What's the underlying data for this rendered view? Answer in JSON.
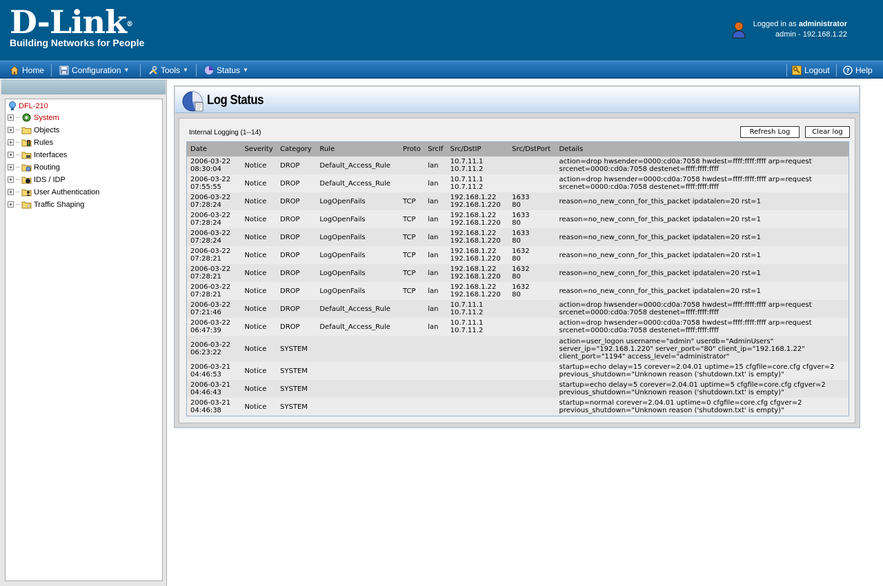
{
  "header": {
    "logo_main": "D-Link",
    "logo_reg": "®",
    "logo_tagline": "Building Networks for People",
    "logged_in_prefix": "Logged in as",
    "logged_in_user": "administrator",
    "session_info": "admin - 192.168.1.22"
  },
  "menu": {
    "home": "Home",
    "configuration": "Configuration",
    "tools": "Tools",
    "status": "Status",
    "logout": "Logout",
    "help": "Help"
  },
  "tree": {
    "root": "DFL-210",
    "items": [
      {
        "label": "System",
        "icon": "system-gear-icon",
        "active": true
      },
      {
        "label": "Objects",
        "icon": "folder-icon",
        "active": false
      },
      {
        "label": "Rules",
        "icon": "rules-icon",
        "active": false
      },
      {
        "label": "Interfaces",
        "icon": "interfaces-icon",
        "active": false
      },
      {
        "label": "Routing",
        "icon": "routing-icon",
        "active": false
      },
      {
        "label": "IDS / IDP",
        "icon": "ids-icon",
        "active": false
      },
      {
        "label": "User Authentication",
        "icon": "user-auth-icon",
        "active": false
      },
      {
        "label": "Traffic Shaping",
        "icon": "traffic-shaping-icon",
        "active": false
      }
    ]
  },
  "page": {
    "title": "Log Status",
    "caption": "Internal Logging (1--14)",
    "refresh_label": "Refresh Log",
    "clear_label": "Clear log"
  },
  "log": {
    "columns": [
      "Date",
      "Severity",
      "Category",
      "Rule",
      "Proto",
      "SrcIf",
      "Src/DstIP",
      "Src/DstPort",
      "Details"
    ],
    "rows": [
      {
        "date1": "2006-03-22",
        "date2": "08:30:04",
        "severity": "Notice",
        "category": "DROP",
        "rule": "Default_Access_Rule",
        "proto": "",
        "srcif": "lan",
        "ip1": "10.7.11.1",
        "ip2": "10.7.11.2",
        "port1": "",
        "port2": "",
        "details": "action=drop hwsender=0000:cd0a:7058 hwdest=ffff:ffff:ffff arp=request srcenet=0000:cd0a:7058 destenet=ffff:ffff:ffff"
      },
      {
        "date1": "2006-03-22",
        "date2": "07:55:55",
        "severity": "Notice",
        "category": "DROP",
        "rule": "Default_Access_Rule",
        "proto": "",
        "srcif": "lan",
        "ip1": "10.7.11.1",
        "ip2": "10.7.11.2",
        "port1": "",
        "port2": "",
        "details": "action=drop hwsender=0000:cd0a:7058 hwdest=ffff:ffff:ffff arp=request srcenet=0000:cd0a:7058 destenet=ffff:ffff:ffff"
      },
      {
        "date1": "2006-03-22",
        "date2": "07:28:24",
        "severity": "Notice",
        "category": "DROP",
        "rule": "LogOpenFails",
        "proto": "TCP",
        "srcif": "lan",
        "ip1": "192.168.1.22",
        "ip2": "192.168.1.220",
        "port1": "1633",
        "port2": "80",
        "details": "reason=no_new_conn_for_this_packet ipdatalen=20 rst=1"
      },
      {
        "date1": "2006-03-22",
        "date2": "07:28:24",
        "severity": "Notice",
        "category": "DROP",
        "rule": "LogOpenFails",
        "proto": "TCP",
        "srcif": "lan",
        "ip1": "192.168.1.22",
        "ip2": "192.168.1.220",
        "port1": "1633",
        "port2": "80",
        "details": "reason=no_new_conn_for_this_packet ipdatalen=20 rst=1"
      },
      {
        "date1": "2006-03-22",
        "date2": "07:28:24",
        "severity": "Notice",
        "category": "DROP",
        "rule": "LogOpenFails",
        "proto": "TCP",
        "srcif": "lan",
        "ip1": "192.168.1.22",
        "ip2": "192.168.1.220",
        "port1": "1633",
        "port2": "80",
        "details": "reason=no_new_conn_for_this_packet ipdatalen=20 rst=1"
      },
      {
        "date1": "2006-03-22",
        "date2": "07:28:21",
        "severity": "Notice",
        "category": "DROP",
        "rule": "LogOpenFails",
        "proto": "TCP",
        "srcif": "lan",
        "ip1": "192.168.1.22",
        "ip2": "192.168.1.220",
        "port1": "1632",
        "port2": "80",
        "details": "reason=no_new_conn_for_this_packet ipdatalen=20 rst=1"
      },
      {
        "date1": "2006-03-22",
        "date2": "07:28:21",
        "severity": "Notice",
        "category": "DROP",
        "rule": "LogOpenFails",
        "proto": "TCP",
        "srcif": "lan",
        "ip1": "192.168.1.22",
        "ip2": "192.168.1.220",
        "port1": "1632",
        "port2": "80",
        "details": "reason=no_new_conn_for_this_packet ipdatalen=20 rst=1"
      },
      {
        "date1": "2006-03-22",
        "date2": "07:28:21",
        "severity": "Notice",
        "category": "DROP",
        "rule": "LogOpenFails",
        "proto": "TCP",
        "srcif": "lan",
        "ip1": "192.168.1.22",
        "ip2": "192.168.1.220",
        "port1": "1632",
        "port2": "80",
        "details": "reason=no_new_conn_for_this_packet ipdatalen=20 rst=1"
      },
      {
        "date1": "2006-03-22",
        "date2": "07:21:46",
        "severity": "Notice",
        "category": "DROP",
        "rule": "Default_Access_Rule",
        "proto": "",
        "srcif": "lan",
        "ip1": "10.7.11.1",
        "ip2": "10.7.11.2",
        "port1": "",
        "port2": "",
        "details": "action=drop hwsender=0000:cd0a:7058 hwdest=ffff:ffff:ffff arp=request srcenet=0000:cd0a:7058 destenet=ffff:ffff:ffff"
      },
      {
        "date1": "2006-03-22",
        "date2": "06:47:39",
        "severity": "Notice",
        "category": "DROP",
        "rule": "Default_Access_Rule",
        "proto": "",
        "srcif": "lan",
        "ip1": "10.7.11.1",
        "ip2": "10.7.11.2",
        "port1": "",
        "port2": "",
        "details": "action=drop hwsender=0000:cd0a:7058 hwdest=ffff:ffff:ffff arp=request srcenet=0000:cd0a:7058 destenet=ffff:ffff:ffff"
      },
      {
        "date1": "2006-03-22",
        "date2": "06:23:22",
        "severity": "Notice",
        "category": "SYSTEM",
        "rule": "",
        "proto": "",
        "srcif": "",
        "ip1": "",
        "ip2": "",
        "port1": "",
        "port2": "",
        "details": "action=user_logon username=\"admin\" userdb=\"AdminUsers\" server_ip=\"192.168.1.220\" server_port=\"80\" client_ip=\"192.168.1.22\" client_port=\"1194\" access_level=\"administrator\""
      },
      {
        "date1": "2006-03-21",
        "date2": "04:46:53",
        "severity": "Notice",
        "category": "SYSTEM",
        "rule": "",
        "proto": "",
        "srcif": "",
        "ip1": "",
        "ip2": "",
        "port1": "",
        "port2": "",
        "details": "startup=echo delay=15 corever=2.04.01 uptime=15 cfgfile=core.cfg cfgver=2 previous_shutdown=\"Unknown reason ('shutdown.txt' is empty)\""
      },
      {
        "date1": "2006-03-21",
        "date2": "04:46:43",
        "severity": "Notice",
        "category": "SYSTEM",
        "rule": "",
        "proto": "",
        "srcif": "",
        "ip1": "",
        "ip2": "",
        "port1": "",
        "port2": "",
        "details": "startup=echo delay=5 corever=2.04.01 uptime=5 cfgfile=core.cfg cfgver=2 previous_shutdown=\"Unknown reason ('shutdown.txt' is empty)\""
      },
      {
        "date1": "2006-03-21",
        "date2": "04:46:38",
        "severity": "Notice",
        "category": "SYSTEM",
        "rule": "",
        "proto": "",
        "srcif": "",
        "ip1": "",
        "ip2": "",
        "port1": "",
        "port2": "",
        "details": "startup=normal corever=2.04.01 uptime=0 cfgfile=core.cfg cfgver=2 previous_shutdown=\"Unknown reason ('shutdown.txt' is empty)\""
      }
    ]
  }
}
